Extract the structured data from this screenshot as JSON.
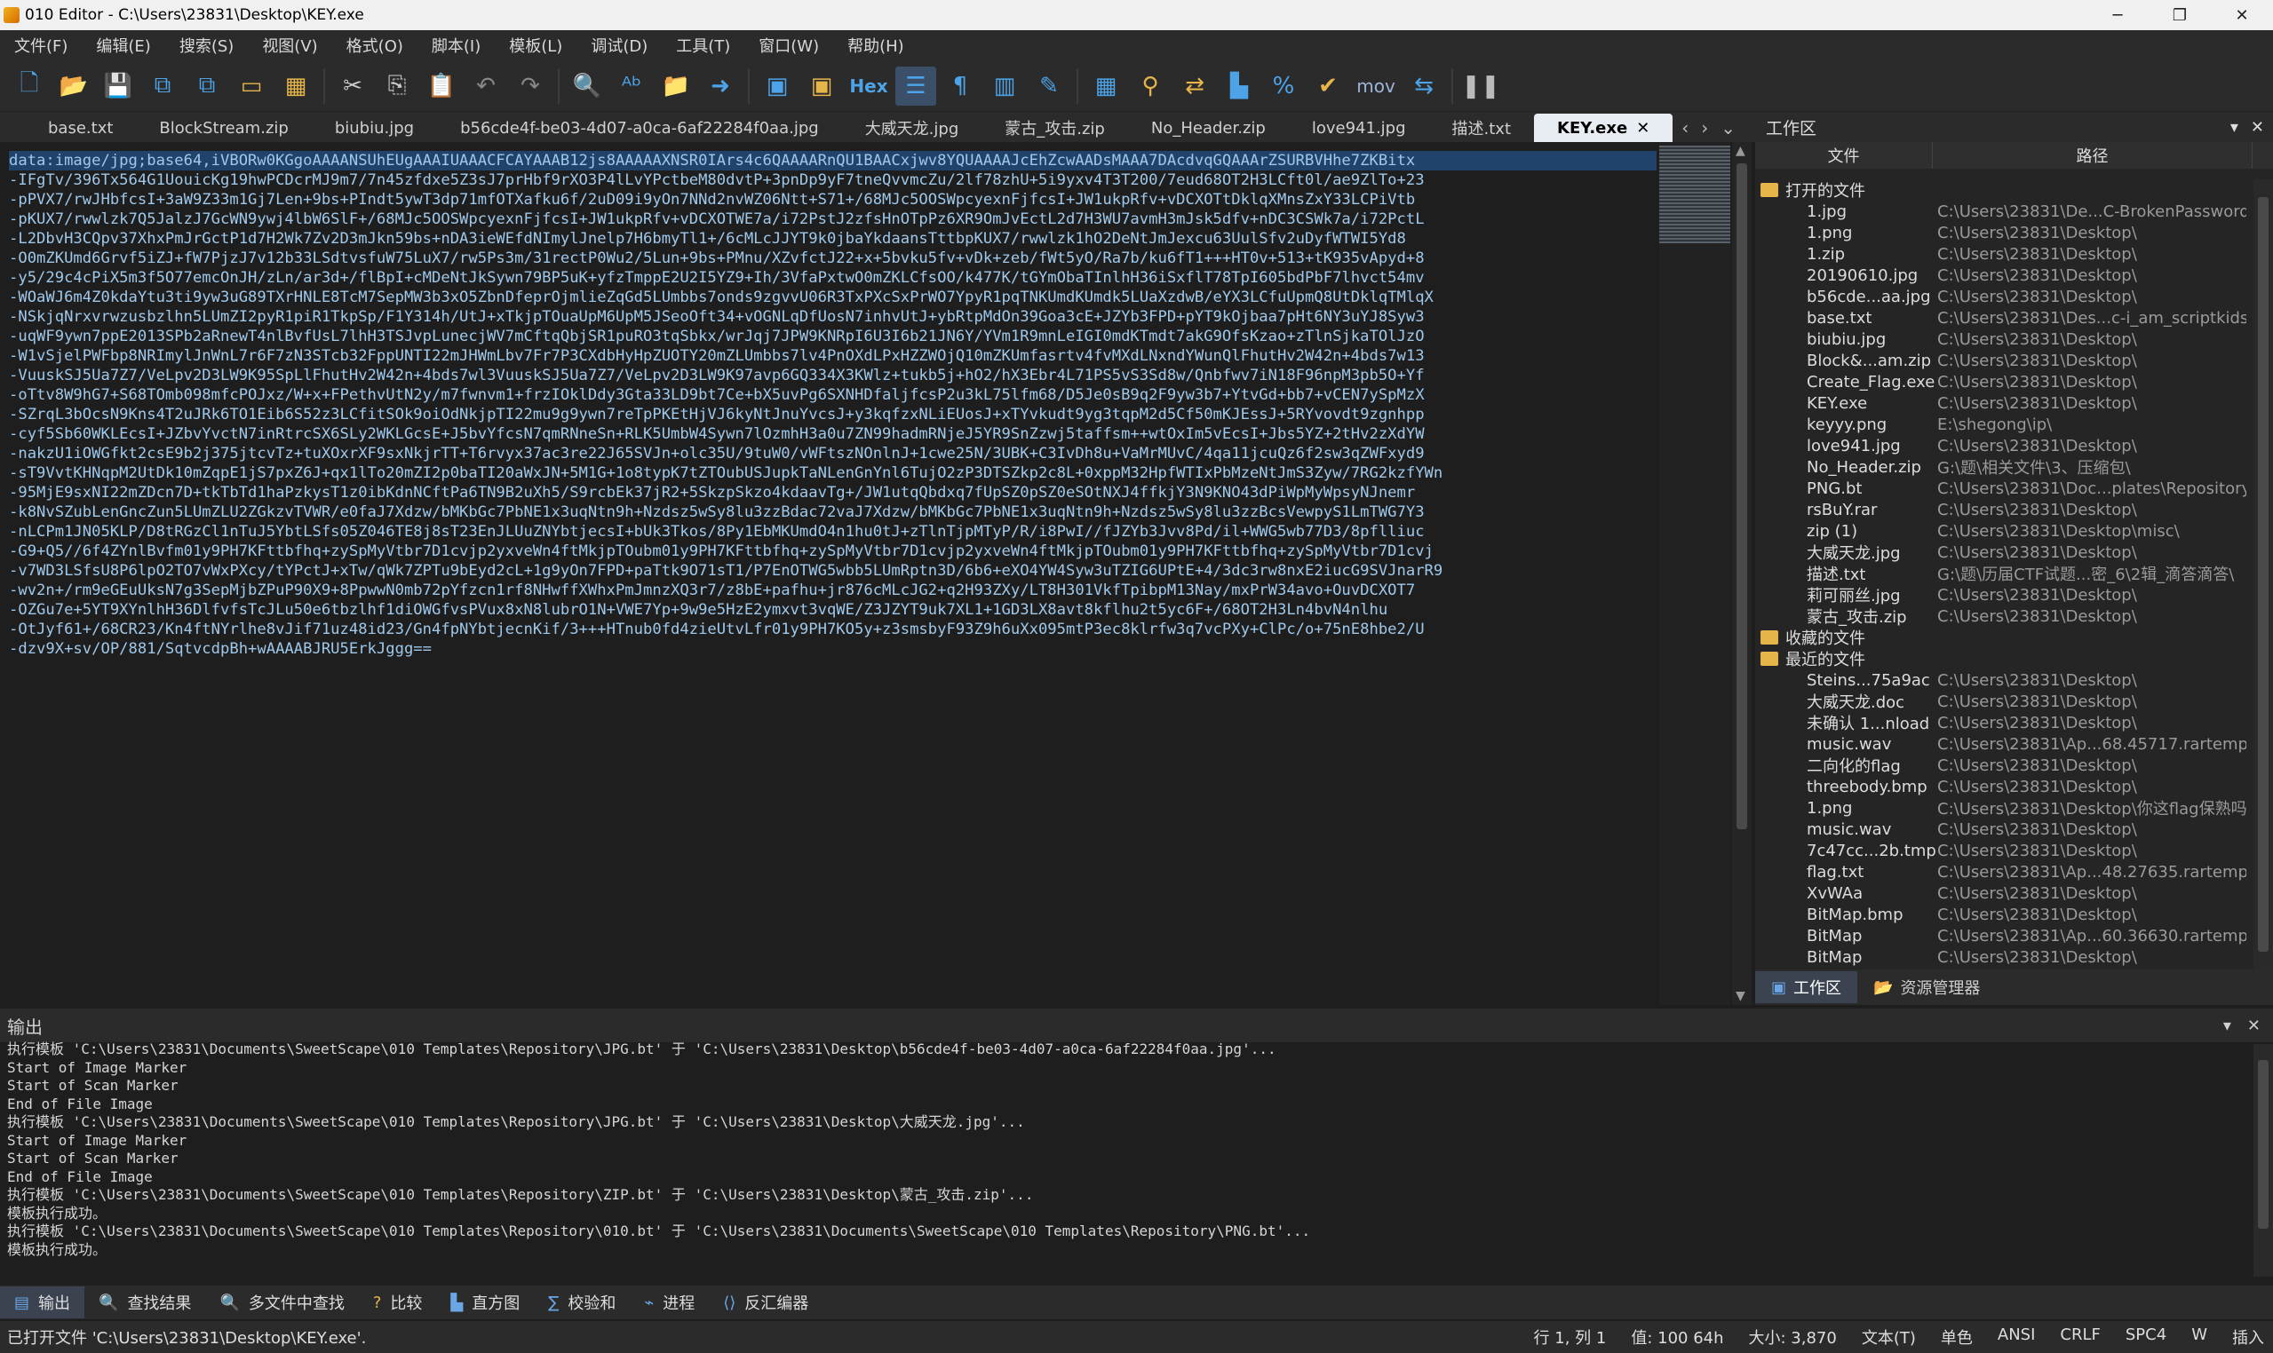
{
  "window": {
    "title": "010 Editor - C:\\Users\\23831\\Desktop\\KEY.exe",
    "minimize": "─",
    "maximize": "❐",
    "close": "✕"
  },
  "menu": [
    "文件(F)",
    "编辑(E)",
    "搜索(S)",
    "视图(V)",
    "格式(O)",
    "脚本(I)",
    "模板(L)",
    "调试(D)",
    "工具(T)",
    "窗口(W)",
    "帮助(H)"
  ],
  "toolbar": {
    "hex_label": "Hex",
    "mov_label": "mov"
  },
  "tabs": [
    {
      "label": "base.txt"
    },
    {
      "label": "BlockStream.zip"
    },
    {
      "label": "biubiu.jpg"
    },
    {
      "label": "b56cde4f-be03-4d07-a0ca-6af22284f0aa.jpg"
    },
    {
      "label": "大威天龙.jpg"
    },
    {
      "label": "蒙古_攻击.zip"
    },
    {
      "label": "No_Header.zip"
    },
    {
      "label": "love941.jpg"
    },
    {
      "label": "描述.txt"
    },
    {
      "label": "KEY.exe",
      "active": true
    }
  ],
  "editor": {
    "lines": [
      "data:image/jpg;base64,iVBORw0KGgoAAAANSUhEUgAAAIUAAACFCAYAAAB12js8AAAAAXNSR0IArs4c6QAAAARnQU1BAACxjwv8YQUAAAAJcEhZcwAADsMAAA7DAcdvqGQAAArZSURBVHhe7ZKBitx",
      "-IFgTv/396Tx564G1UouicKg19hwPCDcrMJ9m7/7n45zfdxe5Z3sJ7prHbf9rXO3P4lLvYPctbeM80dvtP+3pnDp9yF7tneQvvmcZu/2lf78zhU+5i9yxv4T3T200/7eud68OT2H3LCft0l/ae9ZlTo+23",
      "-pPVX7/rwJHbfcsI+3aW9Z33m1Gj7Len+9bs+PIndt5ywT3dp71mfOTXafku6f/2uD09i9yOn7NNd2nvWZ06Ntt+S71+/68MJc5OOSWpcyexnFjfcsI+JW1ukpRfv+vDCXOTtDklqXMnsZxY33LCPiVtb",
      "-pKUX7/rwwlzk7Q5JalzJ7GcWN9ywj4lbW6SlF+/68MJc5OOSWpcyexnFjfcsI+JW1ukpRfv+vDCXOTWE7a/i72PstJ2zfsHnOTpPz6XR9OmJvEctL2d7H3WU7avmH3mJsk5dfv+nDC3CSWk7a/i72PctL",
      "-L2DbvH3CQpv37XhxPmJrGctP1d7H2Wk7Zv2D3mJkn59bs+nDA3ieWEfdNImylJnelp7H6bmyTl1+/6cMLcJJYT9k0jbaYkdaansTttbpKUX7/rwwlzk1hO2DeNtJmJexcu63UulSfv2uDyfWTWI5Yd8",
      "-O0mZKUmd6Grvf5iZJ+fW7PjzJ7v12b33LSdtvsfuW75LuX7/rw5Ps3m/31rectP0Wu2/5Lun+9bs+PMnu/XZvfctJ22+x+5bvku5fv+vDk+zeb/fWt5yO/Ra7b/ku6fT1+++HT0v+513+tK935vApyd+8",
      "-y5/29c4cPiX5m3f5O77emcOnJH/zLn/ar3d+/flBpI+cMDeNtJkSywn79BP5uK+yfzTmppE2U2I5YZ9+Ih/3VfaPxtwO0mZKLCfsOO/k477K/tGYmObaTInlhH36iSxflT78TpI605bdPbF7lhvct54mv",
      "-WOaWJ6m4Z0kdaYtu3ti9yw3uG89TXrHNLE8TcM7SepMW3b3xO5ZbnDfeprOjmlieZqGd5LUmbbs7onds9zgvvU06R3TxPXcSxPrWO7YpyR1pqTNKUmdKUmdk5LUaXzdwB/eYX3LCfuUpmQ8UtDklqTMlqX",
      "-NSkjqNrxvrwzusbzlhn5LUmZI2pyR1piR1TkpSp/F1Y314h/UtJ+xTkjpTOuaUpM6UpM5JSeoOft34+vOGNLqDfUosN7inhvUtJ+ybRtpMdOn39Goa3cE+JZYb3FPD+pYT9kOjbaa7pHt6NY3uYJ8Syw3",
      "-uqWF9ywn7ppE2013SPb2aRnewT4nlBvfUsL7lhH3TSJvpLunecjWV7mCftqQbjSR1puRO3tqSbkx/wrJqj7JPW9KNRpI6U3I6b21JN6Y/YVm1R9mnLeIGI0mdKTmdt7akG9OfsKzao+zTlnSjkaTOlJzO",
      "-W1vSjelPWFbp8NRImylJnWnL7r6F7zN3STcb32FppUNTI22mJHWmLbv7Fr7P3CXdbHyHpZUOTY20mZLUmbbs7lv4PnOXdLPxHZZWOjQ10mZKUmfasrtv4fvMXdLNxndYWunQlFhutHv2W42n+4bds7w13",
      "-VuuskSJ5Ua7Z7/VeLpv2D3LW9K95SpLlFhutHv2W42n+4bds7wl3VuuskSJ5Ua7Z7/VeLpv2D3LW9K97avp6GQ334X3KWlz+tukb5j+hO2/hX3Ebr4L71PS5vS3Sd8w/Qnbfwv7iN18F96npM3pb5O+Yf",
      "-oTtv8W9hG7+S68TOmb098mfcPOJxz/W+x+FPethvUtN2y/m7fwnvm1+frzIOklDdy3Gta33LD9bt7Ce+bX5uvPg6SXNHDfaljfcsP2u3kL75lfm68/D5Je0sB9q2F9yw3b7+YtvGd+bb7+vCEN7ySpMzX",
      "-SZrqL3bOcsN9Kns4T2uJRk6TO1Eib6S52z3LCfitSOk9oiOdNkjpTI22mu9g9ywn7reTpPKEtHjVJ6kyNtJnuYvcsJ+y3kqfzxNLiEUosJ+xTYvkudt9yg3tqpM2d5Cf50mKJEssJ+5RYvovdt9zgnhpp",
      "-cyf5Sb60WKLEcsI+JZbvYvctN7inRtrcSX6SLy2WKLGcsE+J5bvYfcsN7qmRNneSn+RLK5UmbW4Sywn7lOzmhH3a0u7ZN99hadmRNjeJ5YR9SnZzwj5taffsm++wtOxIm5vEcsI+Jbs5YZ+2tHv2zXdYW",
      "-nakzU1iOWGfkt2csE9b2j375jtcvTz+tuXOxrXF9sxNkjrTT+T6rvyx37ac3re22J65SVJn+olc35U/9tuW0/vWFtszNOnlnJ+1cwe25N/3UBK+C3IvDh8u+VaMrMUvC/4qa11jcuQz6f2sw3qZWFxyd9",
      "-sT9VvtKHNqpM2UtDk10mZqpE1jS7pxZ6J+qx1lTo20mZI2p0baTI20aWxJN+5M1G+1o8typK7tZTOubUSJupkTaNLenGnYnl6TujO2zP3DTSZkp2c8L+0xppM32HpfWTIxPbMzeNtJmS3Zyw/7RG2kzfYWn",
      "-95MjE9sxNI22mZDcn7D+tkTbTd1haPzkysT1z0ibKdnNCftPa6TN9B2uXh5/S9rcbEk37jR2+5SkzpSkzo4kdaavTg+/JW1utqQbdxq7fUpSZ0pSZ0eSOtNXJ4ffkjY3N9KNO43dPiWpMyWpsyNJnemr",
      "-k8NvSZubLenGncZun5LUmZLU2ZGkzvTVWR/e0faJ7Xdzw/bMKbGc7PbNE1x3uqNtn9h+Nzdsz5wSy8lu3zzBdac72vaJ7Xdzw/bMKbGc7PbNE1x3uqNtn9h+Nzdsz5wSy8lu3zzBcsVewpyS1LmTWG7Y3",
      "-nLCPm1JN05KLP/D8tRGzCl1nTuJ5YbtLSfs05Z046TE8j8sT23EnJLUuZNYbtjecsI+bUk3Tkos/8Py1EbMKUmdO4n1hu0tJ+zTlnTjpMTyP/R/i8PwI//fJZYb3Jvv8Pd/il+WWG5wb77D3/8pflliuc",
      "-G9+Q5//6f4ZYnlBvfm01y9PH7KFttbfhq+zySpMyVtbr7D1cvjp2yxveWn4ftMkjpTOubm01y9PH7KFttbfhq+zySpMyVtbr7D1cvjp2yxveWn4ftMkjpTOubm01y9PH7KFttbfhq+zySpMyVtbr7D1cvj",
      "-v7WD3LSfsU8P6lpO2TO7vWxPXcy/tYPctJ+xTw/qWk7ZPTu9bEyd2cL+1g9yOn7FPD+paTtk9O71sT1/P7EnOTWG5wbb5LUmRptn3D/6b6+eXO4YW4Syw3uTZIG6UPtE+4/3dc3rw8nxE2iucG9SVJnarR9",
      "-wv2n+/rm9eGEuUksN7g3SepMjbZPuP90X9+8PpwwN0mb72pYfzcn1rf8NHwffXWhxPmJmnzXQ3r7/z8bE+pafhu+jr876cMLcJG2+q2H93ZXy/LT8H301VkfTpibpM13Nay/mxPrW34avo+OuvDCXOT7",
      "-OZGu7e+5YT9XYnlhH36DlfvfsTcJLu50e6tbzlhf1diOWGfvsPVux8xN8lubrO1N+VWE7Yp+9w9e5HzE2ymxvt3vqWE/Z3JZYT9uk7XL1+1GD3LX8avt8kflhu2t5yc6F+/68OT2H3Ln4bvN4nlhu",
      "-OtJyf61+/68CR23/Kn4ftNYrlhe8vJif71uz48id23/Gn4fpNYbtjecnKif/3+++HTnub0fd4zieUtvLfr01y9PH7KO5y+z3smsbyF93Z9h6uXx095mtP3ec8klrfw3q7vcPXy+ClPc/o+75nE8hbe2/U",
      "-dzv9X+sv/OP/881/SqtvcdpBh+wAAAABJRU5ErkJggg=="
    ]
  },
  "workspace": {
    "title": "工作区",
    "col_file": "文件",
    "col_path": "路径",
    "groups": [
      {
        "label": "打开的文件",
        "items": [
          {
            "name": "1.jpg",
            "path": "C:\\Users\\23831\\De...C-BrokenPassword\\"
          },
          {
            "name": "1.png",
            "path": "C:\\Users\\23831\\Desktop\\"
          },
          {
            "name": "1.zip",
            "path": "C:\\Users\\23831\\Desktop\\"
          },
          {
            "name": "20190610.jpg",
            "path": "C:\\Users\\23831\\Desktop\\"
          },
          {
            "name": "b56cde...aa.jpg",
            "path": "C:\\Users\\23831\\Desktop\\"
          },
          {
            "name": "base.txt",
            "path": "C:\\Users\\23831\\Des...c-i_am_scriptkids\\"
          },
          {
            "name": "biubiu.jpg",
            "path": "C:\\Users\\23831\\Desktop\\"
          },
          {
            "name": "Block&...am.zip",
            "path": "C:\\Users\\23831\\Desktop\\"
          },
          {
            "name": "Create_Flag.exe",
            "path": "C:\\Users\\23831\\Desktop\\"
          },
          {
            "name": "KEY.exe",
            "path": "C:\\Users\\23831\\Desktop\\"
          },
          {
            "name": "keyyy.png",
            "path": "E:\\shegong\\ip\\"
          },
          {
            "name": "love941.jpg",
            "path": "C:\\Users\\23831\\Desktop\\"
          },
          {
            "name": "No_Header.zip",
            "path": "G:\\题\\相关文件\\3、压缩包\\"
          },
          {
            "name": "PNG.bt",
            "path": "C:\\Users\\23831\\Doc...plates\\Repository\\"
          },
          {
            "name": "rsBuY.rar",
            "path": "C:\\Users\\23831\\Desktop\\"
          },
          {
            "name": "zip (1)",
            "path": "C:\\Users\\23831\\Desktop\\misc\\"
          },
          {
            "name": "大威天龙.jpg",
            "path": "C:\\Users\\23831\\Desktop\\"
          },
          {
            "name": "描述.txt",
            "path": "G:\\题\\历届CTF试题...密_6\\2辑_滴答滴答\\"
          },
          {
            "name": "莉可丽丝.jpg",
            "path": "C:\\Users\\23831\\Desktop\\"
          },
          {
            "name": "蒙古_攻击.zip",
            "path": "C:\\Users\\23831\\Desktop\\"
          }
        ]
      },
      {
        "label": "收藏的文件",
        "items": []
      },
      {
        "label": "最近的文件",
        "items": [
          {
            "name": "Steins...75a9ac",
            "path": "C:\\Users\\23831\\Desktop\\"
          },
          {
            "name": "大威天龙.doc",
            "path": "C:\\Users\\23831\\Desktop\\"
          },
          {
            "name": "未确认 1...nload",
            "path": "C:\\Users\\23831\\Desktop\\"
          },
          {
            "name": "music.wav",
            "path": "C:\\Users\\23831\\Ap...68.45717.rartemp\\"
          },
          {
            "name": "二向化的flag",
            "path": "C:\\Users\\23831\\Desktop\\"
          },
          {
            "name": "threebody.bmp",
            "path": "C:\\Users\\23831\\Desktop\\"
          },
          {
            "name": "1.png",
            "path": "C:\\Users\\23831\\Desktop\\你这flag保熟吗\\"
          },
          {
            "name": "music.wav",
            "path": "C:\\Users\\23831\\Desktop\\"
          },
          {
            "name": "7c47cc...2b.tmp",
            "path": "C:\\Users\\23831\\Desktop\\"
          },
          {
            "name": "flag.txt",
            "path": "C:\\Users\\23831\\Ap...48.27635.rartemp\\"
          },
          {
            "name": "XvWAa",
            "path": "C:\\Users\\23831\\Desktop\\"
          },
          {
            "name": "BitMap.bmp",
            "path": "C:\\Users\\23831\\Desktop\\"
          },
          {
            "name": "BitMap",
            "path": "C:\\Users\\23831\\Ap...60.36630.rartemp\\"
          },
          {
            "name": "BitMap",
            "path": "C:\\Users\\23831\\Desktop\\"
          }
        ]
      }
    ],
    "bottom_tabs": [
      "工作区",
      "资源管理器"
    ]
  },
  "output": {
    "title": "输出",
    "lines": [
      "执行模板 'C:\\Users\\23831\\Documents\\SweetScape\\010 Templates\\Repository\\JPG.bt' 于 'C:\\Users\\23831\\Desktop\\b56cde4f-be03-4d07-a0ca-6af22284f0aa.jpg'...",
      "Start of Image Marker",
      "Start of Scan Marker",
      "End of File Image",
      "执行模板 'C:\\Users\\23831\\Documents\\SweetScape\\010 Templates\\Repository\\JPG.bt' 于 'C:\\Users\\23831\\Desktop\\大威天龙.jpg'...",
      "Start of Image Marker",
      "Start of Scan Marker",
      "End of File Image",
      "执行模板 'C:\\Users\\23831\\Documents\\SweetScape\\010 Templates\\Repository\\ZIP.bt' 于 'C:\\Users\\23831\\Desktop\\蒙古_攻击.zip'...",
      "模板执行成功。",
      "执行模板 'C:\\Users\\23831\\Documents\\SweetScape\\010 Templates\\Repository\\010.bt' 于 'C:\\Users\\23831\\Documents\\SweetScape\\010 Templates\\Repository\\PNG.bt'...",
      "模板执行成功。"
    ],
    "tabs": [
      {
        "label": "输出",
        "icon": "▤"
      },
      {
        "label": "查找结果",
        "icon": "🔍"
      },
      {
        "label": "多文件中查找",
        "icon": "🔍"
      },
      {
        "label": "比较",
        "icon": "?"
      },
      {
        "label": "直方图",
        "icon": "▙"
      },
      {
        "label": "校验和",
        "icon": "∑"
      },
      {
        "label": "进程",
        "icon": "⌁"
      },
      {
        "label": "反汇编器",
        "icon": "⟨⟩"
      }
    ]
  },
  "status": {
    "message": "已打开文件 'C:\\Users\\23831\\Desktop\\KEY.exe'.",
    "position": "行 1, 列 1",
    "value": "值: 100 64h",
    "size": "大小: 3,870",
    "mode": "文本(T)",
    "char": "单色",
    "encoding": "ANSI",
    "eol": "CRLF",
    "tabs": "SPC4",
    "w": "W",
    "insert": "插入"
  }
}
